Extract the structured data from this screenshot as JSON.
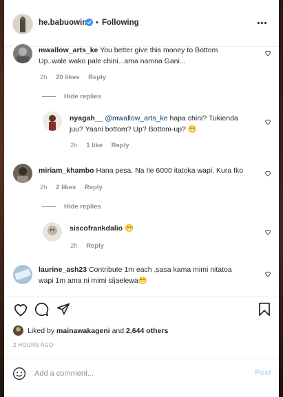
{
  "header": {
    "username": "he.babuowino",
    "separator": "•",
    "follow_status": "Following"
  },
  "comments": [
    {
      "username": "mwallow_arts_ke",
      "text": "You better give this money to Bottom",
      "text2": "Up..wale wako pale chini...ama namna Gani...",
      "time": "2h",
      "likes": "20 likes",
      "reply": "Reply"
    },
    {
      "username": "nyagah__",
      "mention": "@mwallow_arts_ke",
      "text": "hapa chini? Tukienda",
      "text2": "juu? Yaani bottom? Up? Bottom-up? 😁",
      "time": "2h",
      "likes": "1 like",
      "reply": "Reply"
    },
    {
      "username": "miriam_khambo",
      "text": "Hana pesa. Na Ile 6000 itatoka wapi. Kura Iko",
      "time": "2h",
      "likes": "2 likes",
      "reply": "Reply"
    },
    {
      "username": "siscofrankdalio",
      "text": "😁",
      "time": "2h",
      "reply": "Reply"
    },
    {
      "username": "laurine_ash23",
      "text": "Contribute 1m each ,sasa kama mimi nitatoa",
      "text2": "wapi 1m ama ni mimi sijaelewa😁"
    }
  ],
  "hide_replies": "Hide replies",
  "likes_summary": {
    "prefix": "Liked by",
    "user": "mainawakageni",
    "middle": "and",
    "others": "2,644 others"
  },
  "time_ago": "2 HOURS AGO",
  "add_comment": {
    "placeholder": "Add a comment...",
    "post_label": "Post"
  },
  "icons": {
    "verified": "verified-badge-icon",
    "more": "more-options-icon",
    "heart": "heart-icon",
    "comment": "comment-icon",
    "share": "share-icon",
    "save": "bookmark-icon",
    "emoji": "emoji-icon"
  },
  "colors": {
    "verified": "#3897f0",
    "post_button": "#b2dffc",
    "mention": "#00376b",
    "meta": "#8e8e8e"
  }
}
